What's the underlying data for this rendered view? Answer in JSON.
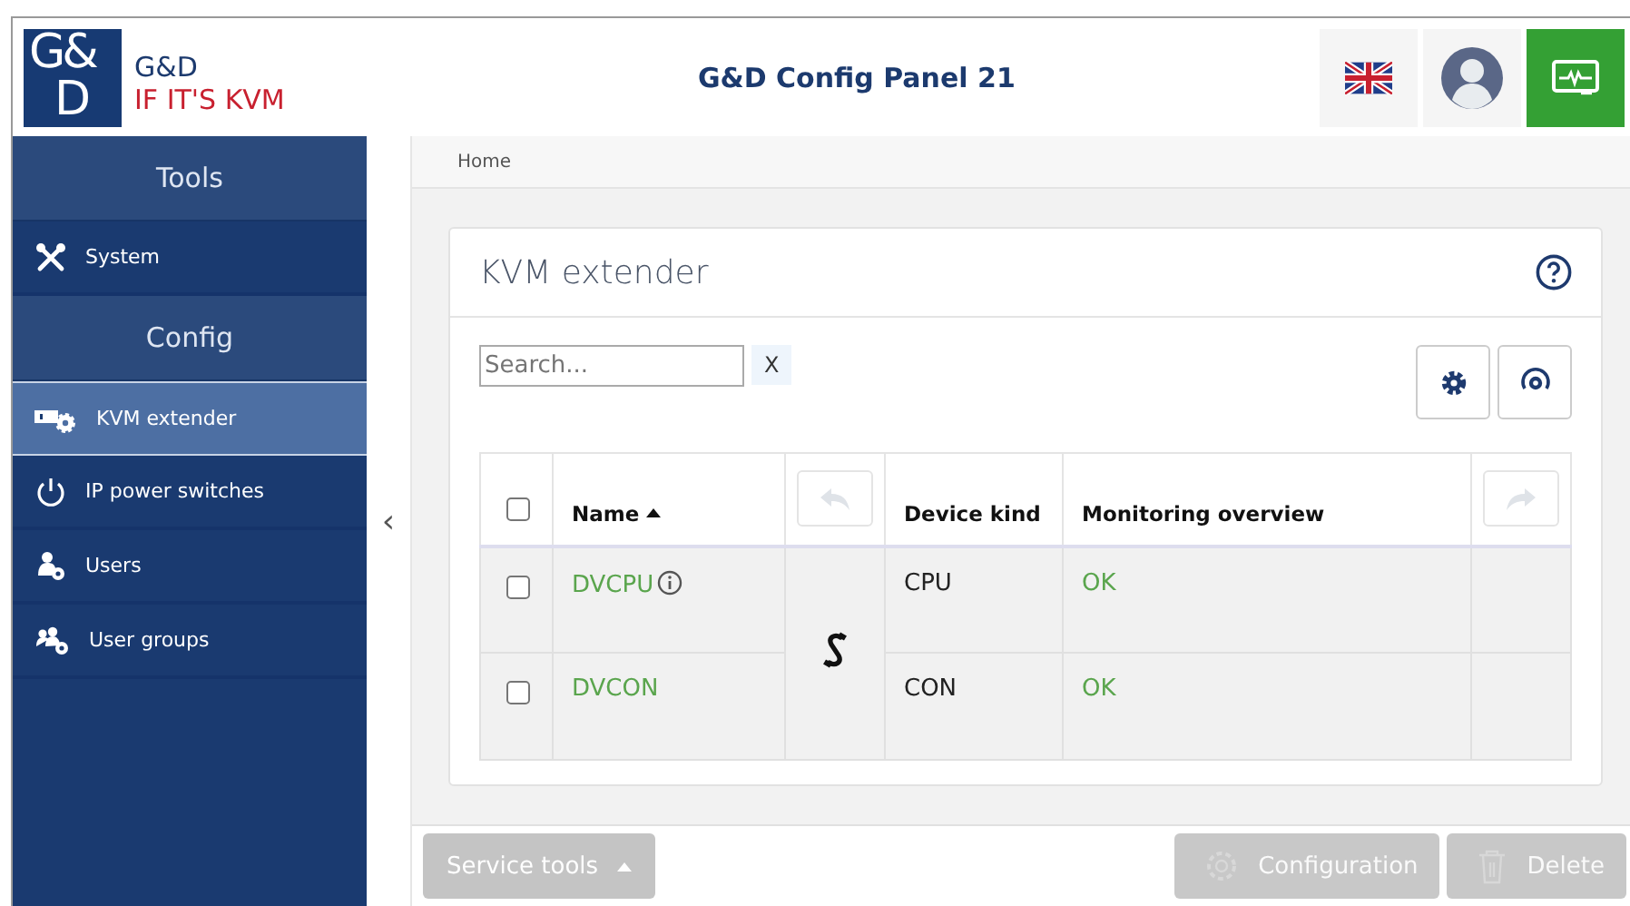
{
  "header": {
    "logo_mark": [
      "G&",
      "D"
    ],
    "brand": "G&D",
    "slogan": "IF IT'S KVM",
    "title": "G&D Config Panel 21"
  },
  "sidebar": {
    "items": [
      {
        "kind": "header",
        "label": "Tools"
      },
      {
        "kind": "tools",
        "label": "System",
        "selected": false
      },
      {
        "kind": "header",
        "label": "Config"
      },
      {
        "kind": "extender",
        "label": "KVM extender",
        "selected": true
      },
      {
        "kind": "power",
        "label": "IP power switches",
        "selected": false
      },
      {
        "kind": "user",
        "label": "Users",
        "selected": false
      },
      {
        "kind": "users",
        "label": "User groups",
        "selected": false
      }
    ],
    "collapse": "‹"
  },
  "breadcrumb": "Home",
  "panel": {
    "title": "KVM extender",
    "search": {
      "placeholder": "Search...",
      "clear": "X"
    },
    "table": {
      "select_all_checked": false,
      "columns": [
        {
          "label": "Name",
          "sorted": true
        },
        {
          "label": "Device kind",
          "sorted": false
        },
        {
          "label": "Monitoring overview",
          "sorted": false
        }
      ],
      "rows": [
        {
          "checked": false,
          "name": "DVCPU",
          "info": true,
          "kind": "CPU",
          "status": "OK"
        },
        {
          "checked": false,
          "name": "DVCON",
          "info": false,
          "kind": "CON",
          "status": "OK"
        }
      ]
    }
  },
  "footer": {
    "service": "Service tools",
    "buttons": [
      {
        "kind": "configure",
        "label": "Configuration",
        "disabled": true
      },
      {
        "kind": "delete",
        "label": "Delete",
        "disabled": true
      }
    ]
  }
}
